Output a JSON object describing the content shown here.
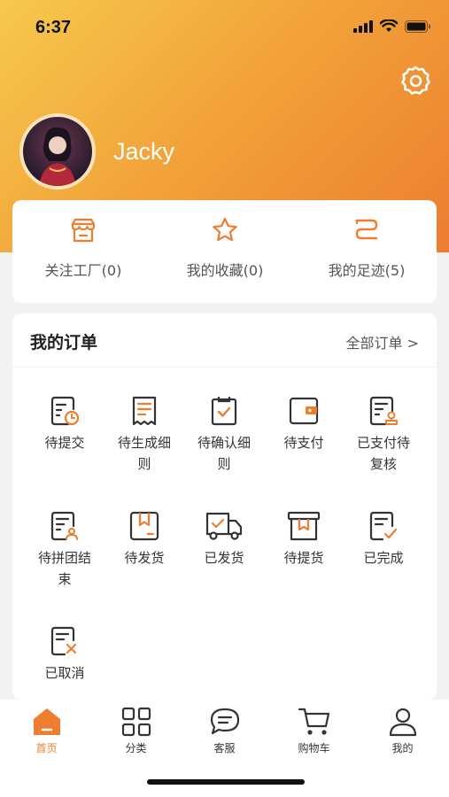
{
  "status": {
    "time": "6:37"
  },
  "profile": {
    "username": "Jacky"
  },
  "quick_links": [
    {
      "label": "关注工厂(0)",
      "icon": "factory-icon"
    },
    {
      "label": "我的收藏(0)",
      "icon": "star-icon"
    },
    {
      "label": "我的足迹(5)",
      "icon": "footprint-icon"
    }
  ],
  "orders": {
    "title": "我的订单",
    "all_label": "全部订单 >",
    "items": [
      {
        "label": "待提交",
        "icon": "doc-clock-icon"
      },
      {
        "label": "待生成细则",
        "icon": "receipt-icon"
      },
      {
        "label": "待确认细则",
        "icon": "clipboard-check-icon"
      },
      {
        "label": "待支付",
        "icon": "wallet-icon"
      },
      {
        "label": "已支付待复核",
        "icon": "doc-stamp-icon"
      },
      {
        "label": "待拼团结束",
        "icon": "doc-group-icon"
      },
      {
        "label": "待发货",
        "icon": "package-icon"
      },
      {
        "label": "已发货",
        "icon": "truck-icon"
      },
      {
        "label": "待提货",
        "icon": "box-icon"
      },
      {
        "label": "已完成",
        "icon": "doc-check-icon"
      },
      {
        "label": "已取消",
        "icon": "doc-cancel-icon"
      }
    ]
  },
  "tabbar": [
    {
      "label": "首页",
      "icon": "home-icon",
      "active": true
    },
    {
      "label": "分类",
      "icon": "grid-icon"
    },
    {
      "label": "客服",
      "icon": "chat-icon"
    },
    {
      "label": "购物车",
      "icon": "cart-icon"
    },
    {
      "label": "我的",
      "icon": "user-icon"
    }
  ],
  "colors": {
    "accent": "#ef7d2d",
    "header_start": "#f6c94c",
    "header_end": "#ec7d2f"
  }
}
